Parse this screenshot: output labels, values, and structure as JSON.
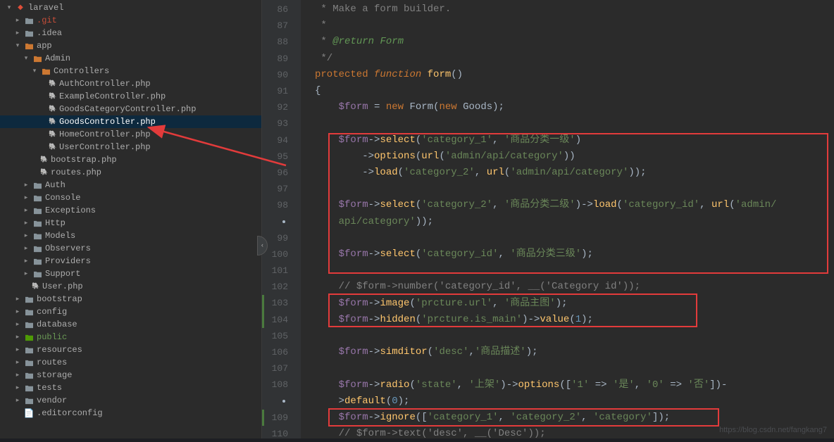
{
  "project": {
    "name": "laravel"
  },
  "tree": [
    {
      "pad": 0,
      "arrow": "open",
      "iconType": "laravel",
      "label": "laravel"
    },
    {
      "pad": 1,
      "arrow": "closed",
      "iconType": "folder",
      "label": ".git",
      "labelClass": "red"
    },
    {
      "pad": 1,
      "arrow": "closed",
      "iconType": "folder",
      "label": ".idea"
    },
    {
      "pad": 1,
      "arrow": "open",
      "iconType": "folder-orange",
      "label": "app"
    },
    {
      "pad": 2,
      "arrow": "open",
      "iconType": "folder-orange",
      "label": "Admin"
    },
    {
      "pad": 3,
      "arrow": "open",
      "iconType": "folder-orange",
      "label": "Controllers"
    },
    {
      "pad": 4,
      "arrow": "none",
      "iconType": "php",
      "label": "AuthController.php"
    },
    {
      "pad": 4,
      "arrow": "none",
      "iconType": "php",
      "label": "ExampleController.php"
    },
    {
      "pad": 4,
      "arrow": "none",
      "iconType": "php",
      "label": "GoodsCategoryController.php"
    },
    {
      "pad": 4,
      "arrow": "none",
      "iconType": "php",
      "label": "GoodsController.php",
      "selected": true
    },
    {
      "pad": 4,
      "arrow": "none",
      "iconType": "php",
      "label": "HomeController.php"
    },
    {
      "pad": 4,
      "arrow": "none",
      "iconType": "php",
      "label": "UserController.php"
    },
    {
      "pad": 3,
      "arrow": "none",
      "iconType": "php",
      "label": "bootstrap.php"
    },
    {
      "pad": 3,
      "arrow": "none",
      "iconType": "php",
      "label": "routes.php"
    },
    {
      "pad": 2,
      "arrow": "closed",
      "iconType": "folder",
      "label": "Auth"
    },
    {
      "pad": 2,
      "arrow": "closed",
      "iconType": "folder",
      "label": "Console"
    },
    {
      "pad": 2,
      "arrow": "closed",
      "iconType": "folder",
      "label": "Exceptions"
    },
    {
      "pad": 2,
      "arrow": "closed",
      "iconType": "folder",
      "label": "Http"
    },
    {
      "pad": 2,
      "arrow": "closed",
      "iconType": "folder",
      "label": "Models"
    },
    {
      "pad": 2,
      "arrow": "closed",
      "iconType": "folder",
      "label": "Observers"
    },
    {
      "pad": 2,
      "arrow": "closed",
      "iconType": "folder",
      "label": "Providers"
    },
    {
      "pad": 2,
      "arrow": "closed",
      "iconType": "folder",
      "label": "Support"
    },
    {
      "pad": 2,
      "arrow": "none",
      "iconType": "php",
      "label": "User.php"
    },
    {
      "pad": 1,
      "arrow": "closed",
      "iconType": "folder",
      "label": "bootstrap"
    },
    {
      "pad": 1,
      "arrow": "closed",
      "iconType": "folder",
      "label": "config"
    },
    {
      "pad": 1,
      "arrow": "closed",
      "iconType": "folder",
      "label": "database"
    },
    {
      "pad": 1,
      "arrow": "closed",
      "iconType": "folder-green",
      "label": "public",
      "labelClass": "green"
    },
    {
      "pad": 1,
      "arrow": "closed",
      "iconType": "folder",
      "label": "resources"
    },
    {
      "pad": 1,
      "arrow": "closed",
      "iconType": "folder",
      "label": "routes"
    },
    {
      "pad": 1,
      "arrow": "closed",
      "iconType": "folder",
      "label": "storage"
    },
    {
      "pad": 1,
      "arrow": "closed",
      "iconType": "folder",
      "label": "tests"
    },
    {
      "pad": 1,
      "arrow": "closed",
      "iconType": "folder",
      "label": "vendor"
    },
    {
      "pad": 1,
      "arrow": "none",
      "iconType": "file",
      "label": ".editorconfig"
    }
  ],
  "code": {
    "lineStart": 86,
    "doc1": "* Make a form builder.",
    "doc2": "*",
    "doc3": "* @return ",
    "doc3b": "Form",
    "doc4": "*/",
    "kw_protected": "protected",
    "kw_function": "function",
    "fn_form": "form",
    "brace_open": "{",
    "var_form": "$form",
    "kw_new": "new",
    "cls_Form": "Form",
    "cls_Goods": "Goods",
    "m_select": "select",
    "str_cat1": "'category_1'",
    "str_cat1_label": "'商品分类一级'",
    "m_options": "options",
    "fn_url": "url",
    "str_adminapi": "'admin/api/category'",
    "m_load": "load",
    "str_cat2": "'category_2'",
    "str_cat2_label": "'商品分类二级'",
    "str_catid": "'category_id'",
    "str_adminapi2": "'admin/api/category'",
    "str_catid_label": "'商品分类三级'",
    "comment_number": "// $form->number('category_id', __('Category id'));",
    "m_image": "image",
    "str_prcture_url": "'prcture.url'",
    "str_main_img": "'商品主图'",
    "m_hidden": "hidden",
    "str_prcture_ismain": "'prcture.is_main'",
    "m_value": "value",
    "num_1": "1",
    "m_simditor": "simditor",
    "str_desc": "'desc'",
    "str_desc_label": "'商品描述'",
    "m_radio": "radio",
    "str_state": "'state'",
    "str_state_label": "'上架'",
    "str_options_arr_open": "([",
    "str_key1": "'1'",
    "str_val1": "'是'",
    "str_key0": "'0'",
    "str_val0": "'否'",
    "m_default": "default",
    "num_0": "0",
    "m_ignore": "ignore",
    "str_category": "'category'",
    "comment_text": "// $form->text('desc', __('Desc'));"
  },
  "watermark": "https://blog.csdn.net/fangkang7"
}
